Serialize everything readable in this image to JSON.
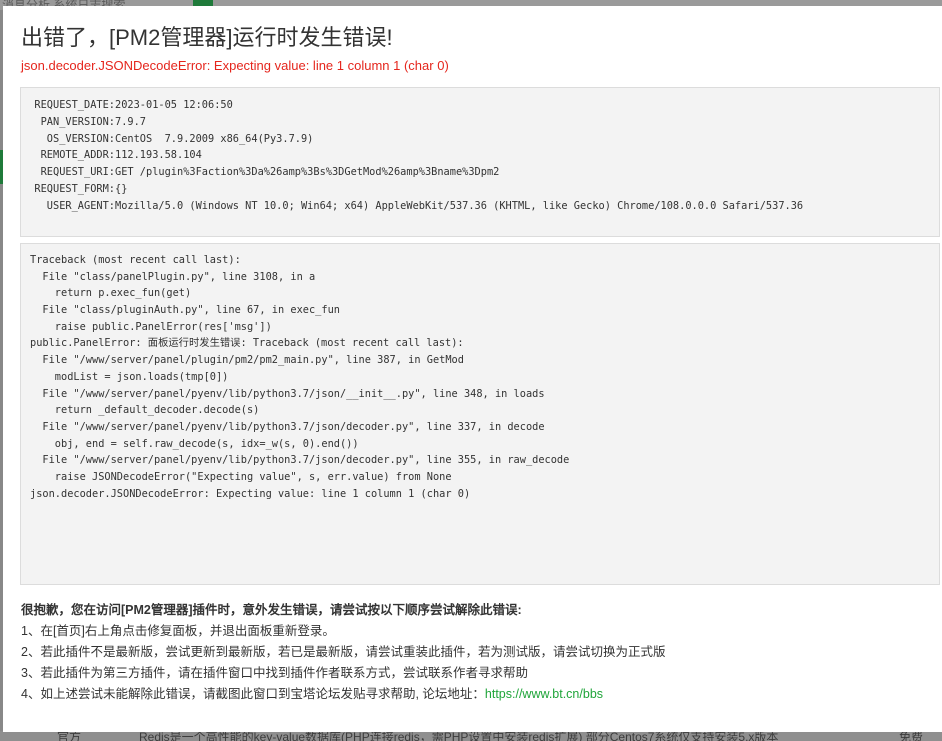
{
  "background": {
    "top_text": "消息分析    系统日志搜索",
    "bottom_texts": [
      "官方",
      "Redis是一个高性能的key-value数据库(PHP连接redis，需PHP设置中安装redis扩展) 部分Centos7系统仅支持安装5.x版本",
      "免费"
    ]
  },
  "dialog": {
    "title": "出错了，[PM2管理器]运行时发生错误!",
    "error_message": "json.decoder.JSONDecodeError: Expecting value: line 1 column 1 (char 0)",
    "request_info": [
      {
        "key": "REQUEST_DATE:",
        "value": "2023-01-05 12:06:50"
      },
      {
        "key": "PAN_VERSION:",
        "value": "7.9.7"
      },
      {
        "key": "OS_VERSION:",
        "value": "CentOS  7.9.2009 x86_64(Py3.7.9)"
      },
      {
        "key": "REMOTE_ADDR:",
        "value": "112.193.58.104"
      },
      {
        "key": "REQUEST_URI:",
        "value": "GET /plugin%3Faction%3Da%26amp%3Bs%3DGetMod%26amp%3Bname%3Dpm2"
      },
      {
        "key": "REQUEST_FORM:",
        "value": "{}"
      },
      {
        "key": "USER_AGENT:",
        "value": "Mozilla/5.0 (Windows NT 10.0; Win64; x64) AppleWebKit/537.36 (KHTML, like Gecko) Chrome/108.0.0.0 Safari/537.36"
      }
    ],
    "traceback": [
      "Traceback (most recent call last):",
      "  File \"class/panelPlugin.py\", line 3108, in a",
      "    return p.exec_fun(get)",
      "  File \"class/pluginAuth.py\", line 67, in exec_fun",
      "    raise public.PanelError(res['msg'])",
      "public.PanelError: 面板运行时发生错误: Traceback (most recent call last):",
      "  File \"/www/server/panel/plugin/pm2/pm2_main.py\", line 387, in GetMod",
      "    modList = json.loads(tmp[0])",
      "  File \"/www/server/panel/pyenv/lib/python3.7/json/__init__.py\", line 348, in loads",
      "    return _default_decoder.decode(s)",
      "  File \"/www/server/panel/pyenv/lib/python3.7/json/decoder.py\", line 337, in decode",
      "    obj, end = self.raw_decode(s, idx=_w(s, 0).end())",
      "  File \"/www/server/panel/pyenv/lib/python3.7/json/decoder.py\", line 355, in raw_decode",
      "    raise JSONDecodeError(\"Expecting value\", s, err.value) from None",
      "json.decoder.JSONDecodeError: Expecting value: line 1 column 1 (char 0)"
    ],
    "help": {
      "heading": "很抱歉，您在访问[PM2管理器]插件时，意外发生错误，请尝试按以下顺序尝试解除此错误:",
      "steps": [
        "1、在[首页]右上角点击修复面板，并退出面板重新登录。",
        "2、若此插件不是最新版，尝试更新到最新版，若已是最新版，请尝试重装此插件，若为测试版，请尝试切换为正式版",
        "3、若此插件为第三方插件，请在插件窗口中找到插件作者联系方式，尝试联系作者寻求帮助"
      ],
      "step4_text": "4、如上述尝试未能解除此错误，请截图此窗口到宝塔论坛发贴寻求帮助, 论坛地址：",
      "forum_link": "https://www.bt.cn/bbs"
    }
  }
}
